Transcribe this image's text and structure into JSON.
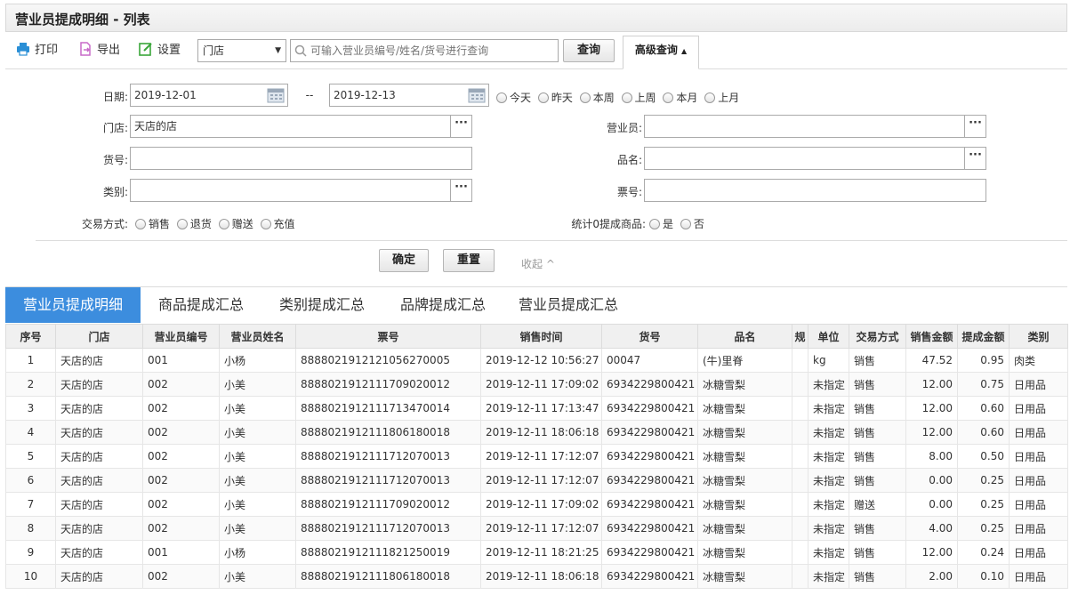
{
  "title": "营业员提成明细 - 列表",
  "toolbar": {
    "print": "打印",
    "export": "导出",
    "settings": "设置",
    "store_select": "门店",
    "search_placeholder": "可输入营业员编号/姓名/货号进行查询",
    "query": "查询",
    "advanced": "高级查询"
  },
  "filters": {
    "date_label": "日期:",
    "date_from": "2019-12-01",
    "date_sep": "--",
    "date_to": "2019-12-13",
    "quick_dates": [
      "今天",
      "昨天",
      "本周",
      "上周",
      "本月",
      "上月"
    ],
    "store_label": "门店:",
    "store_value": "天店的店",
    "clerk_label": "营业员:",
    "sku_label": "货号:",
    "name_label": "品名:",
    "category_label": "类别:",
    "ticket_label": "票号:",
    "trade_label": "交易方式:",
    "trade_options": [
      "销售",
      "退货",
      "赠送",
      "充值"
    ],
    "zero_label": "统计0提成商品:",
    "zero_options": [
      "是",
      "否"
    ],
    "more_icon": "ellipsis-icon",
    "calendar_icon": "calendar-icon"
  },
  "actions": {
    "confirm": "确定",
    "reset": "重置",
    "collapse": "收起 ^"
  },
  "tabs": [
    "营业员提成明细",
    "商品提成汇总",
    "类别提成汇总",
    "品牌提成汇总",
    "营业员提成汇总"
  ],
  "colors": {
    "accent": "#3c8dde",
    "print_icon": "#2a8fd6",
    "export_icon": "#c86ac8",
    "settings_icon": "#3aa63a"
  },
  "table": {
    "headers": [
      "序号",
      "门店",
      "营业员编号",
      "营业员姓名",
      "票号",
      "销售时间",
      "货号",
      "品名",
      "规",
      "单位",
      "交易方式",
      "销售金额",
      "提成金额",
      "类别"
    ],
    "rows": [
      [
        "1",
        "天店的店",
        "001",
        "小杨",
        "888802191212105627000​5",
        "2019-12-12 10:56:27",
        "00047",
        "(牛)里脊",
        "",
        "kg",
        "销售",
        "47.52",
        "0.95",
        "肉类"
      ],
      [
        "2",
        "天店的店",
        "002",
        "小美",
        "8888021912111709020012",
        "2019-12-11 17:09:02",
        "6934229800421",
        "冰糖雪梨",
        "",
        "未指定",
        "销售",
        "12.00",
        "0.75",
        "日用品"
      ],
      [
        "3",
        "天店的店",
        "002",
        "小美",
        "8888021912111713470014",
        "2019-12-11 17:13:47",
        "6934229800421",
        "冰糖雪梨",
        "",
        "未指定",
        "销售",
        "12.00",
        "0.60",
        "日用品"
      ],
      [
        "4",
        "天店的店",
        "002",
        "小美",
        "8888021912111806180018",
        "2019-12-11 18:06:18",
        "6934229800421",
        "冰糖雪梨",
        "",
        "未指定",
        "销售",
        "12.00",
        "0.60",
        "日用品"
      ],
      [
        "5",
        "天店的店",
        "002",
        "小美",
        "8888021912111712070013",
        "2019-12-11 17:12:07",
        "6934229800421",
        "冰糖雪梨",
        "",
        "未指定",
        "销售",
        "8.00",
        "0.50",
        "日用品"
      ],
      [
        "6",
        "天店的店",
        "002",
        "小美",
        "8888021912111712070013",
        "2019-12-11 17:12:07",
        "6934229800421",
        "冰糖雪梨",
        "",
        "未指定",
        "销售",
        "0.00",
        "0.25",
        "日用品"
      ],
      [
        "7",
        "天店的店",
        "002",
        "小美",
        "8888021912111709020012",
        "2019-12-11 17:09:02",
        "6934229800421",
        "冰糖雪梨",
        "",
        "未指定",
        "赠送",
        "0.00",
        "0.25",
        "日用品"
      ],
      [
        "8",
        "天店的店",
        "002",
        "小美",
        "8888021912111712070013",
        "2019-12-11 17:12:07",
        "6934229800421",
        "冰糖雪梨",
        "",
        "未指定",
        "销售",
        "4.00",
        "0.25",
        "日用品"
      ],
      [
        "9",
        "天店的店",
        "001",
        "小杨",
        "8888021912111821250019",
        "2019-12-11 18:21:25",
        "6934229800421",
        "冰糖雪梨",
        "",
        "未指定",
        "销售",
        "12.00",
        "0.24",
        "日用品"
      ],
      [
        "10",
        "天店的店",
        "002",
        "小美",
        "8888021912111806180018",
        "2019-12-11 18:06:18",
        "6934229800421",
        "冰糖雪梨",
        "",
        "未指定",
        "销售",
        "2.00",
        "0.10",
        "日用品"
      ]
    ]
  }
}
